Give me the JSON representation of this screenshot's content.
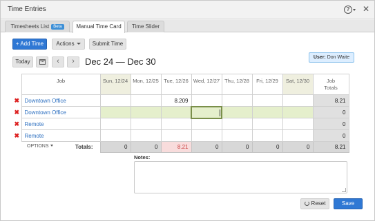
{
  "window": {
    "title": "Time Entries"
  },
  "tabs": [
    {
      "label": "Timesheets List",
      "badge": "Beta"
    },
    {
      "label": "Manual Time Card"
    },
    {
      "label": "Time Slider"
    }
  ],
  "toolbar": {
    "add_time_label": "+ Add Time",
    "actions_label": "Actions",
    "submit_time_label": "Submit Time"
  },
  "user_badge": {
    "prefix": "User:",
    "name": "Don Waite"
  },
  "date_nav": {
    "today_label": "Today",
    "prev_icon": "chevron-left-icon",
    "next_icon": "chevron-right-icon",
    "range": "Dec 24 — Dec 30"
  },
  "grid": {
    "job_header": "Job",
    "day_headers": [
      "Sun, 12/24",
      "Mon, 12/25",
      "Tue, 12/26",
      "Wed, 12/27",
      "Thu, 12/28",
      "Fri, 12/29",
      "Sat, 12/30"
    ],
    "totals_header_line1": "Job",
    "totals_header_line2": "Totals",
    "rows": [
      {
        "job": "Downtown Office",
        "hours": [
          "",
          "",
          "8.209",
          "",
          "",
          "",
          ""
        ],
        "total": "8.21"
      },
      {
        "job": "Downtown Office",
        "hours": [
          "",
          "",
          "",
          "",
          "",
          "",
          ""
        ],
        "total": "0"
      },
      {
        "job": "Remote",
        "hours": [
          "",
          "",
          "",
          "",
          "",
          "",
          ""
        ],
        "total": "0"
      },
      {
        "job": "Remote",
        "hours": [
          "",
          "",
          "",
          "",
          "",
          "",
          ""
        ],
        "total": "0"
      }
    ],
    "options_label": "OPTIONS",
    "totals_label": "Totals:",
    "day_totals": [
      "0",
      "0",
      "8.21",
      "0",
      "0",
      "0",
      "0"
    ],
    "grand_total": "8.21",
    "delete_icon": "close-icon"
  },
  "notes": {
    "label": "Notes:",
    "value": ""
  },
  "footer": {
    "reset_label": "Reset",
    "save_label": "Save"
  },
  "colors": {
    "primary": "#2f78d4",
    "link": "#2c6fc0",
    "delete": "#dd2222",
    "weekend_header": "#efefdf",
    "editing_row": "#e5efcc",
    "highlight_total": "#f8dcdc"
  }
}
